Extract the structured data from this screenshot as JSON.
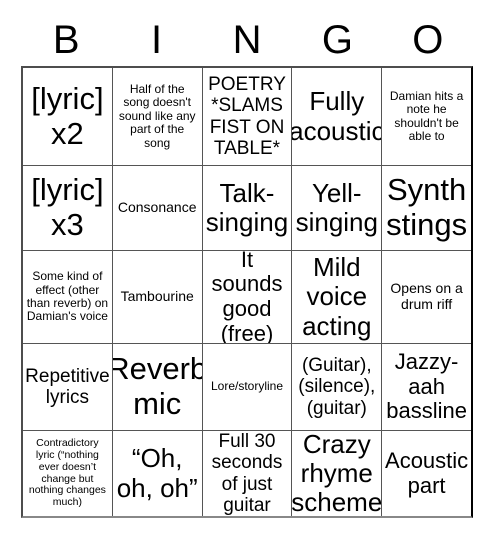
{
  "card": {
    "headers": [
      "B",
      "I",
      "N",
      "G",
      "O"
    ],
    "rows": [
      [
        {
          "text": "[lyric] x2",
          "size": "fs-xxl"
        },
        {
          "text": "Half of the song doesn't sound like any part of the song",
          "size": "fs-xs"
        },
        {
          "text": "POETRY *SLAMS FIST ON TABLE*",
          "size": "fs-md"
        },
        {
          "text": "Fully acoustic",
          "size": "fs-xl"
        },
        {
          "text": "Damian hits a note he shouldn't be able to",
          "size": "fs-xs"
        }
      ],
      [
        {
          "text": "[lyric] x3",
          "size": "fs-xxl"
        },
        {
          "text": "Consonance",
          "size": "fs-sm"
        },
        {
          "text": "Talk-singing",
          "size": "fs-xl"
        },
        {
          "text": "Yell-singing",
          "size": "fs-xl"
        },
        {
          "text": "Synth stings",
          "size": "fs-xxl"
        }
      ],
      [
        {
          "text": "Some kind of effect (other than reverb) on Damian's voice",
          "size": "fs-xs"
        },
        {
          "text": "Tambourine",
          "size": "fs-sm"
        },
        {
          "text": "It sounds good (free)",
          "size": "fs-lg"
        },
        {
          "text": "Mild voice acting",
          "size": "fs-xl"
        },
        {
          "text": "Opens on a drum riff",
          "size": "fs-sm"
        }
      ],
      [
        {
          "text": "Repetitive lyrics",
          "size": "fs-md"
        },
        {
          "text": "Reverb mic",
          "size": "fs-xxl"
        },
        {
          "text": "Lore/storyline",
          "size": "fs-xs"
        },
        {
          "text": "(Guitar), (silence), (guitar)",
          "size": "fs-md"
        },
        {
          "text": "Jazzy-aah bassline",
          "size": "fs-lg"
        }
      ],
      [
        {
          "text": "Contradictory lyric (“nothing ever doesn’t change but nothing changes much)",
          "size": "fs-xxs"
        },
        {
          "text": "“Oh, oh, oh”",
          "size": "fs-xl"
        },
        {
          "text": "Full 30 seconds of just guitar",
          "size": "fs-md"
        },
        {
          "text": "Crazy rhyme scheme",
          "size": "fs-xl"
        },
        {
          "text": "Acoustic part",
          "size": "fs-lg"
        }
      ]
    ]
  },
  "colors": {
    "background": "#ffffff",
    "text": "#000000",
    "grid_line": "#555555",
    "outer_border": "#4d4d4d"
  }
}
